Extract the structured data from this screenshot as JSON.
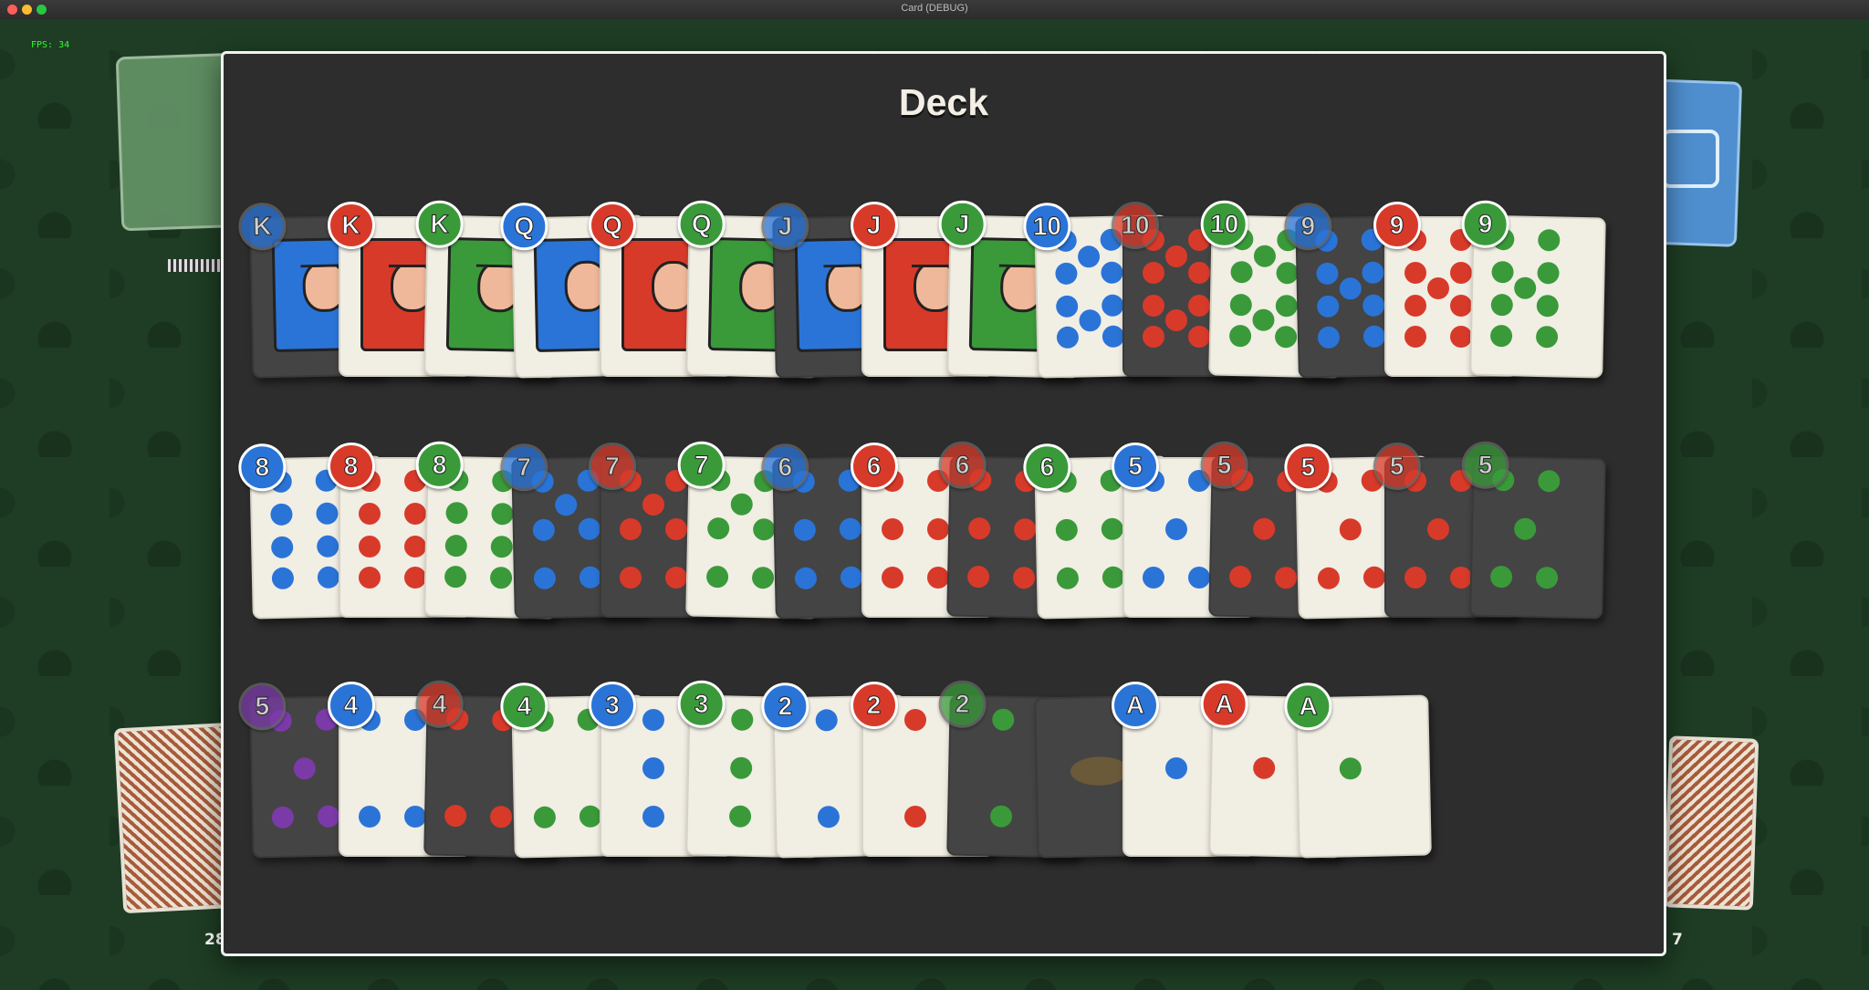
{
  "window": {
    "title": "Card (DEBUG)"
  },
  "hud": {
    "fps": "FPS: 34",
    "left_pile_count": "28",
    "right_pile_count": "7"
  },
  "deck_panel": {
    "title": "Deck",
    "overlay_value": "10"
  },
  "colors": {
    "blue": "#2a74d8",
    "red": "#d83a2a",
    "green": "#3a9a3a",
    "card_face": "#f1eee4",
    "card_dark": "#444444",
    "panel": "#2d2d2d"
  },
  "rows": [
    [
      {
        "rank": "K",
        "suit": "blue",
        "dim": true
      },
      {
        "rank": "K",
        "suit": "red",
        "dim": false
      },
      {
        "rank": "K",
        "suit": "green",
        "dim": false
      },
      {
        "rank": "Q",
        "suit": "blue",
        "dim": false
      },
      {
        "rank": "Q",
        "suit": "red",
        "dim": false
      },
      {
        "rank": "Q",
        "suit": "green",
        "dim": false
      },
      {
        "rank": "J",
        "suit": "blue",
        "dim": true
      },
      {
        "rank": "J",
        "suit": "red",
        "dim": false
      },
      {
        "rank": "J",
        "suit": "green",
        "dim": false
      },
      {
        "rank": "10",
        "suit": "blue",
        "dim": false
      },
      {
        "rank": "10",
        "suit": "red",
        "dim": true
      },
      {
        "rank": "10",
        "suit": "green",
        "dim": false
      },
      {
        "rank": "9",
        "suit": "blue",
        "dim": true
      },
      {
        "rank": "9",
        "suit": "red",
        "dim": false
      },
      {
        "rank": "9",
        "suit": "green",
        "dim": false
      }
    ],
    [
      {
        "rank": "8",
        "suit": "blue",
        "dim": false
      },
      {
        "rank": "8",
        "suit": "red",
        "dim": false
      },
      {
        "rank": "8",
        "suit": "green",
        "dim": false
      },
      {
        "rank": "7",
        "suit": "blue",
        "dim": true
      },
      {
        "rank": "7",
        "suit": "red",
        "dim": true
      },
      {
        "rank": "7",
        "suit": "green",
        "dim": false
      },
      {
        "rank": "6",
        "suit": "blue",
        "dim": true
      },
      {
        "rank": "6",
        "suit": "red",
        "dim": false
      },
      {
        "rank": "6",
        "suit": "red",
        "dim": true
      },
      {
        "rank": "6",
        "suit": "green",
        "dim": false
      },
      {
        "rank": "5",
        "suit": "blue",
        "dim": false
      },
      {
        "rank": "5",
        "suit": "red",
        "dim": true
      },
      {
        "rank": "5",
        "suit": "red",
        "dim": false
      },
      {
        "rank": "5",
        "suit": "red",
        "dim": true
      },
      {
        "rank": "5",
        "suit": "green",
        "dim": true
      }
    ],
    [
      {
        "rank": "5",
        "suit": "purple",
        "dim": true
      },
      {
        "rank": "4",
        "suit": "blue",
        "dim": false
      },
      {
        "rank": "4",
        "suit": "red",
        "dim": true
      },
      {
        "rank": "4",
        "suit": "green",
        "dim": false
      },
      {
        "rank": "3",
        "suit": "blue",
        "dim": false
      },
      {
        "rank": "3",
        "suit": "green",
        "dim": false
      },
      {
        "rank": "2",
        "suit": "blue",
        "dim": false
      },
      {
        "rank": "2",
        "suit": "red",
        "dim": false
      },
      {
        "rank": "2",
        "suit": "green",
        "dim": true
      },
      {
        "rank": "",
        "suit": "special",
        "dim": true
      },
      {
        "rank": "A",
        "suit": "blue",
        "dim": false
      },
      {
        "rank": "A",
        "suit": "red",
        "dim": false
      },
      {
        "rank": "A",
        "suit": "green",
        "dim": false
      }
    ]
  ]
}
